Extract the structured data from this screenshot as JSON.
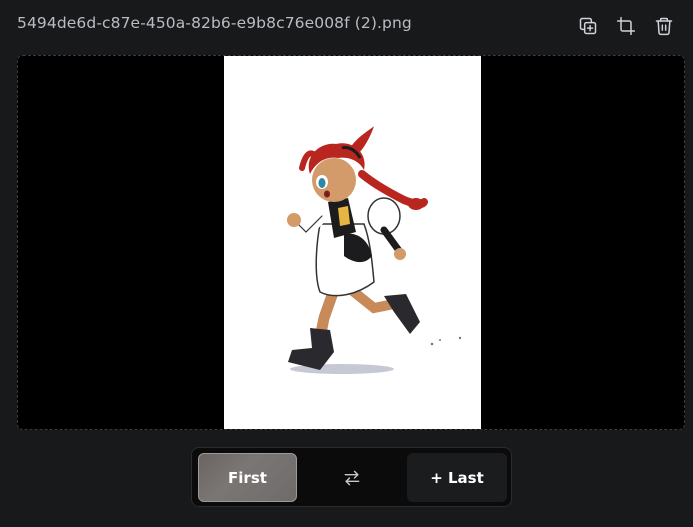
{
  "header": {
    "filename": "5494de6d-c87e-450a-82b6-e9b8c76e008f (2).png",
    "actions": [
      {
        "icon": "duplicate-icon"
      },
      {
        "icon": "crop-icon"
      },
      {
        "icon": "trash-icon"
      }
    ]
  },
  "viewer": {
    "image_description_icon": "running-anime-girl-image"
  },
  "toggle": {
    "first_label": "First",
    "swap_icon": "swap-arrows-icon",
    "last_label": "+ Last"
  },
  "colors": {
    "background": "#18191b",
    "viewer_bg": "#000000",
    "image_bg": "#ffffff",
    "hair": "#b8261f"
  }
}
